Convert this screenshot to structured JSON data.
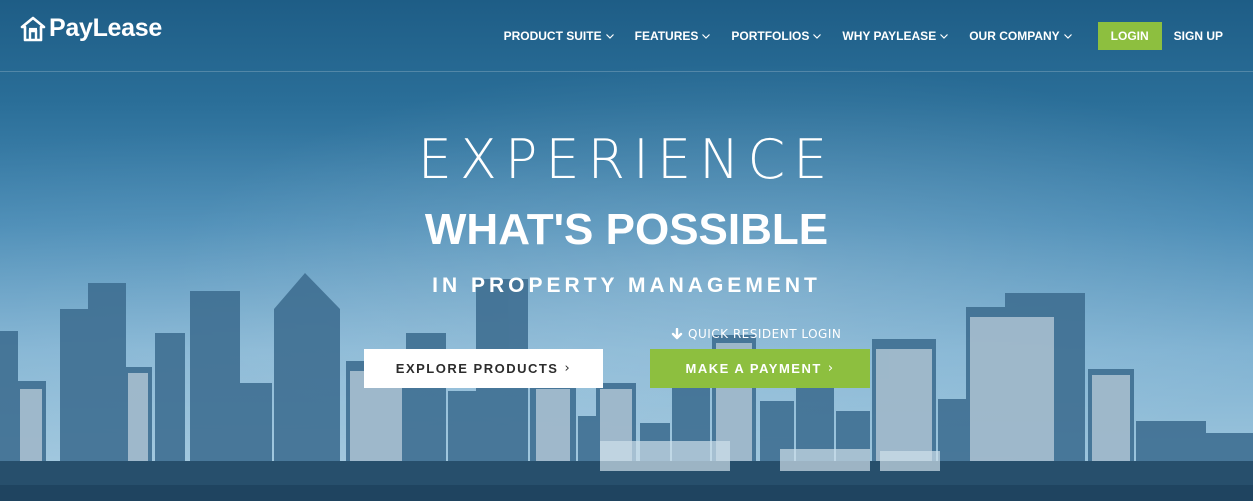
{
  "brand": {
    "logo_text": "PayLease",
    "logo_icon": "house-logo-icon"
  },
  "nav": {
    "items": [
      {
        "label": "PRODUCT SUITE"
      },
      {
        "label": "FEATURES"
      },
      {
        "label": "PORTFOLIOS"
      },
      {
        "label": "WHY PAYLEASE"
      },
      {
        "label": "OUR COMPANY"
      }
    ],
    "login_label": "LOGIN",
    "signup_label": "SIGN UP"
  },
  "hero": {
    "line1": "EXPERIENCE",
    "line2": "WHAT'S POSSIBLE",
    "line3": "IN PROPERTY MANAGEMENT",
    "quick_login": "QUICK RESIDENT LOGIN",
    "explore_label": "EXPLORE PRODUCTS",
    "pay_label": "MAKE A PAYMENT",
    "arrow": "›"
  },
  "colors": {
    "accent": "#8dbf3f",
    "sky_top": "#1e5d86",
    "sky_bottom": "#a6cbe0"
  }
}
